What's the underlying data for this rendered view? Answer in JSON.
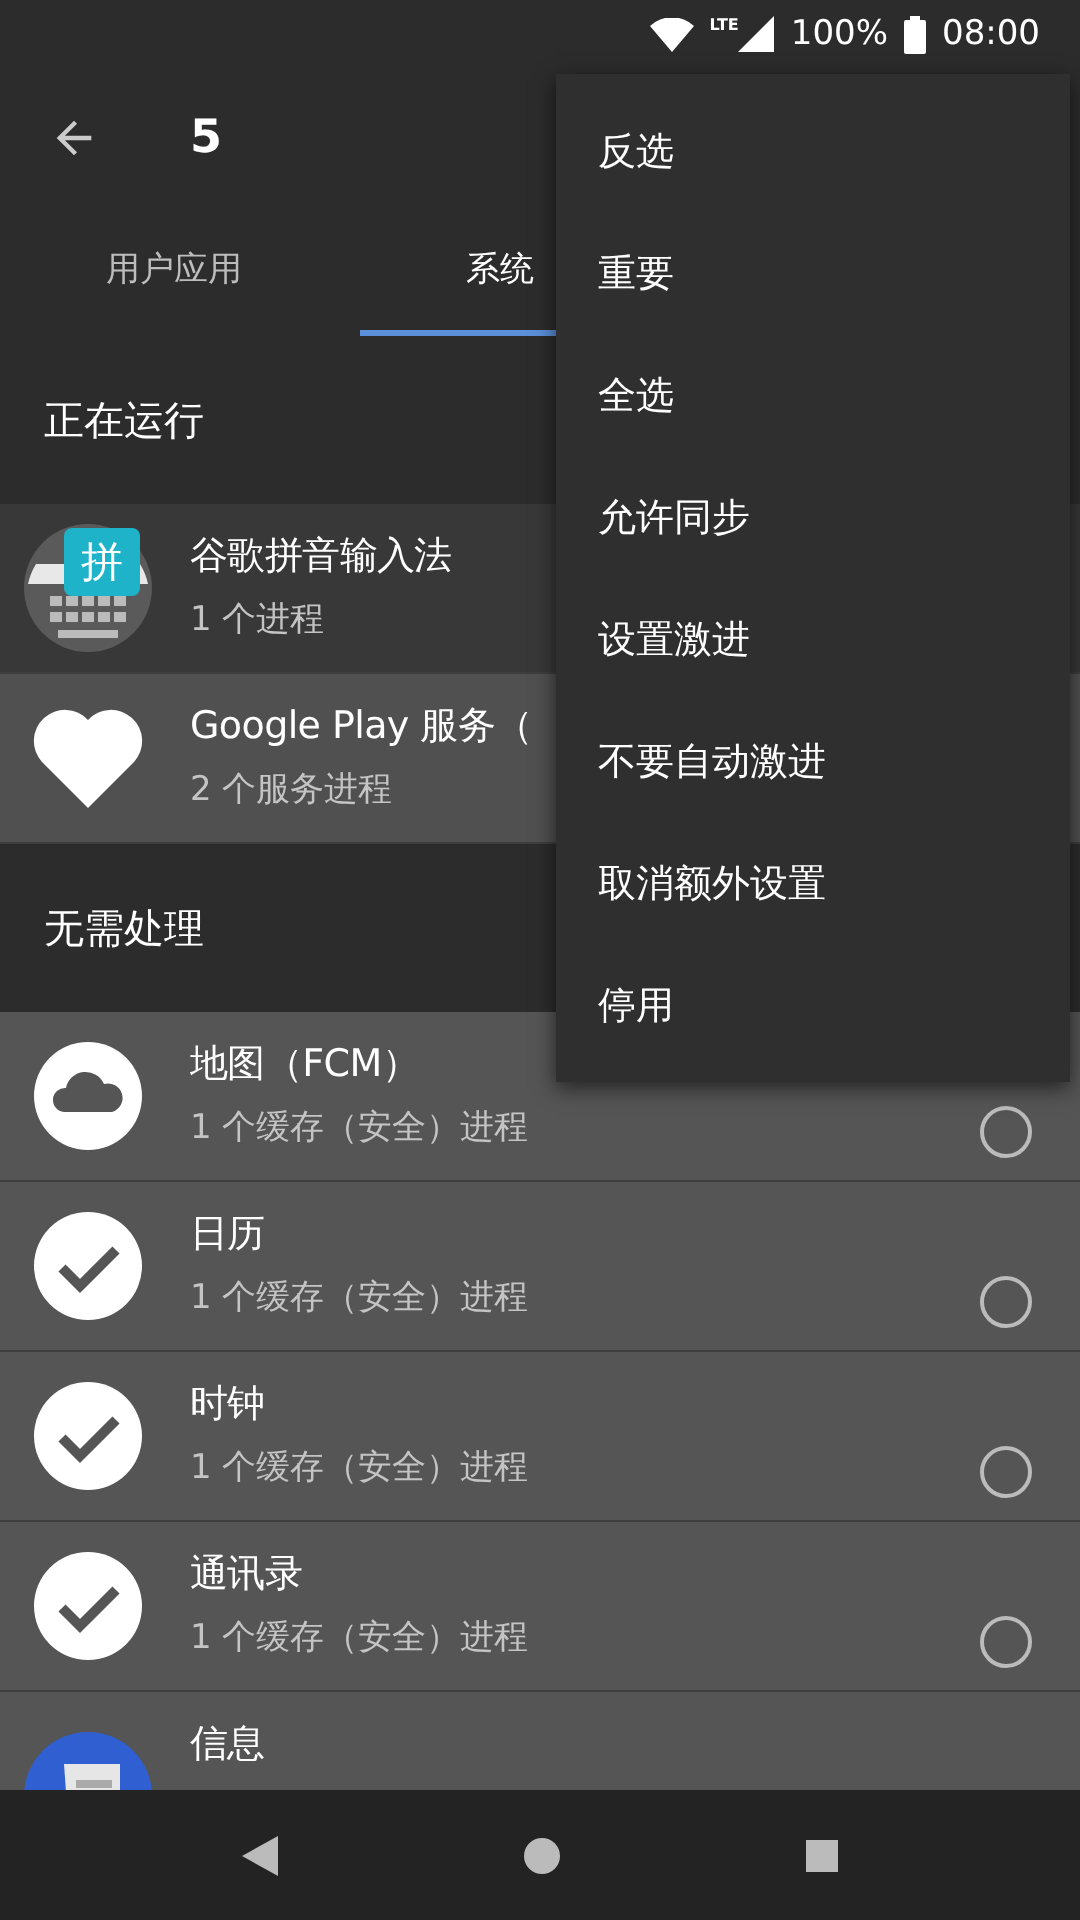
{
  "status_bar": {
    "network": "LTE",
    "battery": "100%",
    "time": "08:00"
  },
  "toolbar": {
    "title": "5"
  },
  "tabs": [
    {
      "label": "用户应用",
      "selected": false
    },
    {
      "label": "系统",
      "selected": true
    }
  ],
  "sections": [
    {
      "title": "正在运行",
      "rows": [
        {
          "kind": "keyboard",
          "badge": "拼",
          "name": "谷歌拼音输入法",
          "detail": "1 个进程",
          "selected": false
        },
        {
          "kind": "heart",
          "name": "Google Play 服务（",
          "detail": "2 个服务进程",
          "selected": true
        }
      ]
    },
    {
      "title": "无需处理",
      "rows": [
        {
          "kind": "cloud",
          "name": "地图（FCM）",
          "detail": "1 个缓存（安全）进程",
          "checked": false
        },
        {
          "kind": "check",
          "name": "日历",
          "detail": "1 个缓存（安全）进程",
          "checked": false
        },
        {
          "kind": "check",
          "name": "时钟",
          "detail": "1 个缓存（安全）进程",
          "checked": false
        },
        {
          "kind": "check",
          "name": "通讯录",
          "detail": "1 个缓存（安全）进程",
          "checked": false
        },
        {
          "kind": "message",
          "name": "信息"
        }
      ]
    }
  ],
  "menu": [
    "反选",
    "重要",
    "全选",
    "允许同步",
    "设置激进",
    "不要自动激进",
    "取消额外设置",
    "停用"
  ]
}
